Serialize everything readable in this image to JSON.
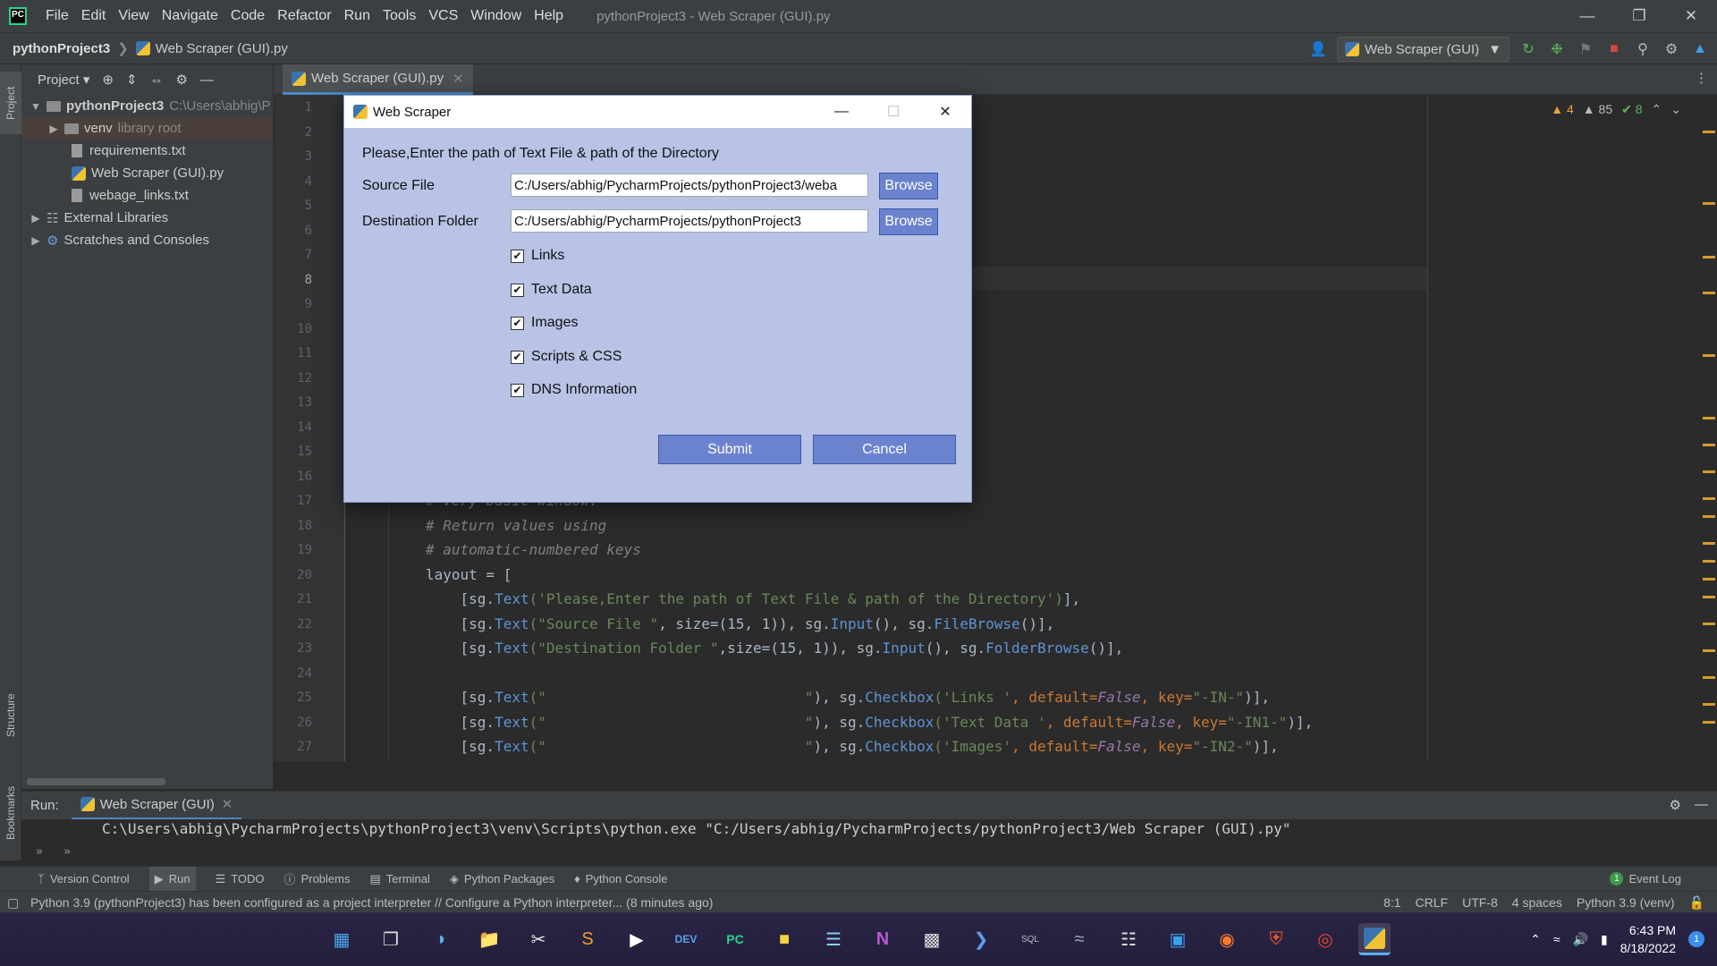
{
  "menubar": {
    "items": [
      "File",
      "Edit",
      "View",
      "Navigate",
      "Code",
      "Refactor",
      "Run",
      "Tools",
      "VCS",
      "Window",
      "Help"
    ],
    "window_title": "pythonProject3 - Web Scraper (GUI).py"
  },
  "navbar": {
    "project": "pythonProject3",
    "file": "Web Scraper (GUI).py",
    "run_config": "Web Scraper (GUI)"
  },
  "left_strip": {
    "project": "Project",
    "structure": "Structure",
    "bookmarks": "Bookmarks"
  },
  "project_panel": {
    "title": "Project",
    "tree": [
      {
        "label": "pythonProject3",
        "hint": "C:\\Users\\abhig\\P"
      },
      {
        "label": "venv",
        "hint": "library root"
      },
      {
        "label": "requirements.txt"
      },
      {
        "label": "Web Scraper (GUI).py"
      },
      {
        "label": "webage_links.txt"
      },
      {
        "label": "External Libraries"
      },
      {
        "label": "Scratches and Consoles"
      }
    ]
  },
  "editor": {
    "tab": "Web Scraper (GUI).py",
    "inspections": {
      "warnings": "4",
      "weak_warnings": "85",
      "typos": "8"
    },
    "line_numbers": [
      "1",
      "2",
      "3",
      "4",
      "5",
      "6",
      "7",
      "8",
      "9",
      "10",
      "11",
      "12",
      "13",
      "14",
      "15",
      "16",
      "17",
      "18",
      "19",
      "20",
      "21",
      "22",
      "23",
      "24",
      "25",
      "26",
      "27"
    ],
    "code": {
      "l17": "# Very basic window.",
      "l18": "# Return values using",
      "l19": "# automatic-numbered keys",
      "l20": "layout = [",
      "l21": [
        "    [sg.",
        "Text",
        "('Please,Enter the path of Text File & path of the Directory')",
        "],"
      ],
      "l22": [
        "    [sg.",
        "Text",
        "(\"Source File \"",
        ", size=(15, 1)), sg.",
        "Input",
        "(), sg.",
        "FileBrowse",
        "()],"
      ],
      "l23": [
        "    [sg.",
        "Text",
        "(\"Destination Folder \"",
        ",size=(15, 1)), sg.",
        "Input",
        "(), sg.",
        "FolderBrowse",
        "()],"
      ],
      "l25": [
        "    [sg.",
        "Text",
        "(\"                              \"",
        "), sg.",
        "Checkbox",
        "('Links '",
        ", default=",
        "False",
        ", key=",
        "\"-IN-\"",
        ")],"
      ],
      "l26": [
        "    [sg.",
        "Text",
        "(\"                              \"",
        "), sg.",
        "Checkbox",
        "('Text Data '",
        ", default=",
        "False",
        ", key=",
        "\"-IN1-\"",
        ")],"
      ],
      "l27": [
        "    [sg.",
        "Text",
        "(\"                              \"",
        "), sg.",
        "Checkbox",
        "('Images'",
        ", default=",
        "False",
        ", key=",
        "\"-IN2-\"",
        ")],"
      ]
    }
  },
  "run_panel": {
    "label": "Run:",
    "tab": "Web Scraper (GUI)",
    "output": "C:\\Users\\abhig\\PycharmProjects\\pythonProject3\\venv\\Scripts\\python.exe \"C:/Users/abhig/PycharmProjects/pythonProject3/Web Scraper (GUI).py\""
  },
  "tool_tabs": [
    "Version Control",
    "Run",
    "TODO",
    "Problems",
    "Terminal",
    "Python Packages",
    "Python Console"
  ],
  "event_log": {
    "count": "1",
    "label": "Event Log"
  },
  "statusbar": {
    "message": "Python 3.9 (pythonProject3) has been configured as a project interpreter // Configure a Python interpreter... (8 minutes ago)",
    "position": "8:1",
    "line_sep": "CRLF",
    "encoding": "UTF-8",
    "indent": "4 spaces",
    "interpreter": "Python 3.9 (venv)"
  },
  "dialog": {
    "title": "Web Scraper",
    "heading": "Please,Enter the path of Text File & path of the Directory",
    "source_label": "Source File",
    "source_value": "C:/Users/abhig/PycharmProjects/pythonProject3/weba",
    "dest_label": "Destination Folder",
    "dest_value": "C:/Users/abhig/PycharmProjects/pythonProject3",
    "browse": "Browse",
    "checkboxes": [
      {
        "label": "Links",
        "checked": true
      },
      {
        "label": "Text Data",
        "checked": true
      },
      {
        "label": "Images",
        "checked": true
      },
      {
        "label": "Scripts & CSS",
        "checked": true
      },
      {
        "label": "DNS Information",
        "checked": true
      }
    ],
    "submit": "Submit",
    "cancel": "Cancel"
  },
  "taskbar": {
    "time": "6:43 PM",
    "date": "8/18/2022",
    "notifications": "1"
  }
}
